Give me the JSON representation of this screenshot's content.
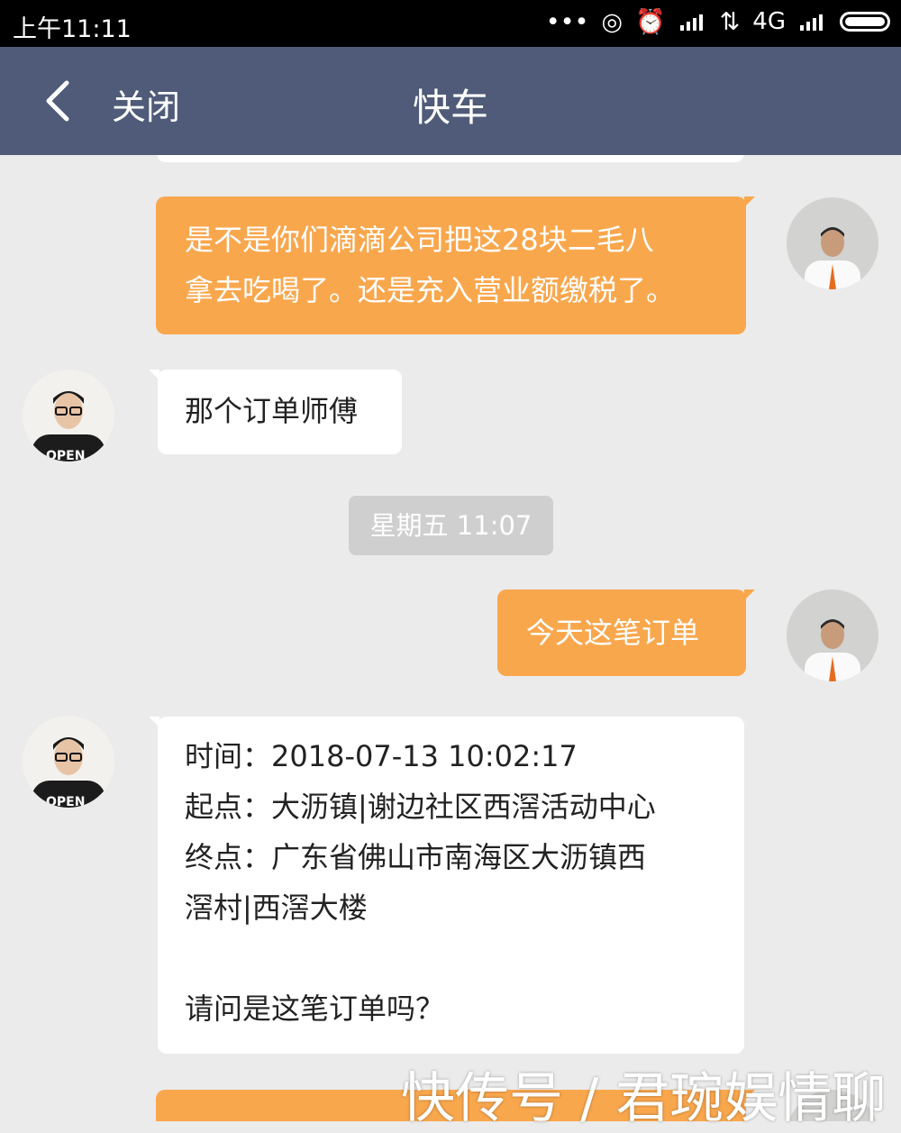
{
  "status_bar": {
    "time": "上午11:11",
    "network": "4G"
  },
  "nav": {
    "close_label": "关闭",
    "title": "快车"
  },
  "messages": [
    {
      "side": "out",
      "lines": [
        "是不是你们滴滴公司把这28块二毛八",
        "拿去吃喝了。还是充入营业额缴税了。"
      ]
    },
    {
      "side": "in",
      "lines": [
        "那个订单师傅"
      ]
    },
    {
      "side": "out",
      "lines": [
        "今天这笔订单"
      ]
    },
    {
      "side": "in",
      "lines": [
        "时间：2018-07-13 10:02:17",
        "起点：大沥镇|谢边社区西滘活动中心",
        "终点：广东省佛山市南海区大沥镇西",
        "滘村|西滘大楼",
        "",
        "请问是这笔订单吗？"
      ]
    }
  ],
  "timestamp": "星期五 11:07",
  "avatar_text": {
    "user_shirt": "OPEN"
  },
  "watermark": "快传号 / 君琬娱情聊",
  "colors": {
    "nav_bg": "#4f5b78",
    "outgoing_bubble": "#f9a74d",
    "incoming_bubble": "#ffffff",
    "background": "#ebebeb"
  }
}
